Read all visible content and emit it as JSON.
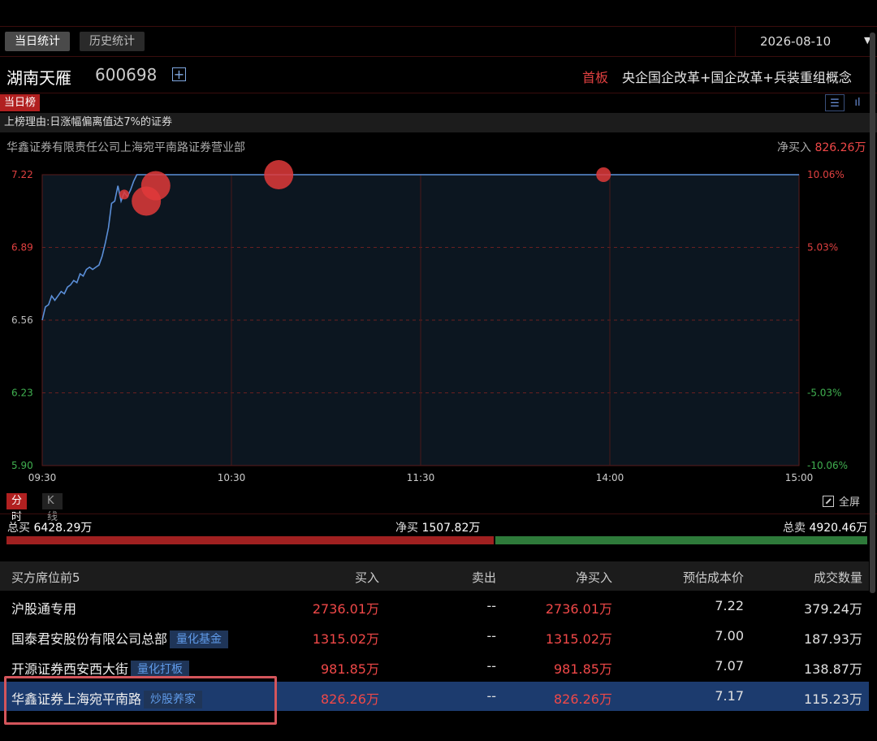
{
  "tabs": {
    "today": "当日统计",
    "history": "历史统计"
  },
  "date": {
    "value": "2026-08-10",
    "caret": "▼"
  },
  "stock": {
    "name": "湖南天雁",
    "code": "600698",
    "plus": "+",
    "board": "首板",
    "concepts": "央企国企改革+国企改革+兵装重组概念"
  },
  "list_tag": "当日榜",
  "view_icons": {
    "list": "☰",
    "bar": "ıl"
  },
  "reason": "上榜理由:日涨幅偏离值达7%的证券",
  "broker": {
    "name": "华鑫证券有限责任公司上海宛平南路证券营业部",
    "net_label": "净买入",
    "net_value": "826.26万"
  },
  "chart_data": {
    "type": "line",
    "title": "",
    "xlabel": "",
    "ylabel": "",
    "y_ticks": [
      "7.22",
      "6.89",
      "6.56",
      "6.23",
      "5.90"
    ],
    "y_tick_values": [
      7.22,
      6.89,
      6.56,
      6.23,
      5.9
    ],
    "pct_ticks": [
      "10.06%",
      "5.03%",
      "",
      "-5.03%",
      "-10.06%"
    ],
    "x_ticks": [
      "09:30",
      "10:30",
      "11:30",
      "14:00",
      "15:00"
    ],
    "ylim": [
      5.9,
      7.22
    ],
    "trading_minutes": 240,
    "price_series": {
      "t": [
        0,
        1,
        2,
        3,
        4,
        5,
        6,
        7,
        8,
        9,
        10,
        11,
        12,
        13,
        14,
        15,
        16,
        17,
        18,
        19,
        20,
        21,
        22,
        23,
        24,
        25,
        26,
        27,
        28,
        29,
        30,
        32,
        240
      ],
      "v": [
        6.56,
        6.62,
        6.63,
        6.67,
        6.65,
        6.67,
        6.69,
        6.68,
        6.71,
        6.72,
        6.74,
        6.73,
        6.77,
        6.76,
        6.79,
        6.8,
        6.79,
        6.8,
        6.81,
        6.85,
        6.91,
        6.98,
        7.09,
        7.1,
        7.17,
        7.1,
        7.14,
        7.12,
        7.15,
        7.19,
        7.22,
        7.22,
        7.22
      ]
    },
    "trade_markers": [
      {
        "t": 26,
        "v": 7.13,
        "size": 2
      },
      {
        "t": 33,
        "v": 7.1,
        "size": 6
      },
      {
        "t": 36,
        "v": 7.17,
        "size": 6
      },
      {
        "t": 75,
        "v": 7.22,
        "size": 6
      },
      {
        "t": 178,
        "v": 7.22,
        "size": 3
      }
    ],
    "grid": "dashed",
    "line_color": "#5b8fd8",
    "marker_color": "#e03a3a"
  },
  "mode_tabs": {
    "intraday": "分时",
    "kline": "K线"
  },
  "fullscreen": "全屏",
  "summary": {
    "total_buy_label": "总买",
    "total_buy": "6428.29万",
    "net_buy_label": "净买",
    "net_buy": "1507.82万",
    "total_sell_label": "总卖",
    "total_sell": "4920.46万",
    "buy_ratio": 0.566
  },
  "table": {
    "headers": [
      "买方席位前5",
      "买入",
      "卖出",
      "净买入",
      "预估成本价",
      "成交数量"
    ],
    "rows": [
      {
        "name": "沪股通专用",
        "tag": "",
        "buy": "2736.01万",
        "sell": "--",
        "net": "2736.01万",
        "cost": "7.22",
        "volume": "379.24万"
      },
      {
        "name": "国泰君安股份有限公司总部",
        "tag": "量化基金",
        "buy": "1315.02万",
        "sell": "--",
        "net": "1315.02万",
        "cost": "7.00",
        "volume": "187.93万"
      },
      {
        "name": "开源证券西安西大街",
        "tag": "量化打板",
        "buy": "981.85万",
        "sell": "--",
        "net": "981.85万",
        "cost": "7.07",
        "volume": "138.87万"
      },
      {
        "name": "华鑫证券上海宛平南路",
        "tag": "炒股养家",
        "buy": "826.26万",
        "sell": "--",
        "net": "826.26万",
        "cost": "7.17",
        "volume": "115.23万"
      }
    ]
  },
  "colors": {
    "up": "#f04848",
    "down": "#2e7a3a",
    "accent": "#b12020",
    "tag_text": "#5f9ae8"
  }
}
